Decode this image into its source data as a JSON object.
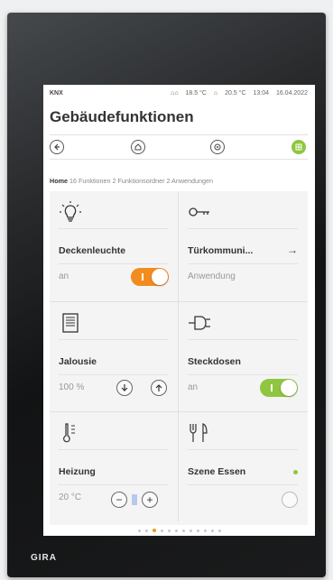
{
  "device": {
    "brand": "GIRA"
  },
  "status": {
    "knx": "KNX",
    "temp_outside": "18.5 °C",
    "temp_inside": "20.5 °C",
    "time": "13:04",
    "date": "16.04.2022"
  },
  "page": {
    "title": "Gebäudefunktionen"
  },
  "nav": {
    "back": "back-icon",
    "home": "home-icon",
    "settings": "settings-icon",
    "grid": "grid-icon"
  },
  "breadcrumb": {
    "home": "Home",
    "info": "16 Funktionen 2 Funktionsordner 2 Anwendungen"
  },
  "tiles": [
    {
      "name": "Deckenleuchte",
      "value": "an",
      "icon": "bulb-icon",
      "switch": "on"
    },
    {
      "name": "Türkommuni...",
      "value": "Anwendung",
      "icon": "key-icon",
      "arrow": "→"
    },
    {
      "name": "Jalousie",
      "value": "100 %",
      "icon": "blind-icon"
    },
    {
      "name": "Steckdosen",
      "value": "an",
      "icon": "plug-icon",
      "switch": "on"
    },
    {
      "name": "Heizung",
      "value": "20 °C",
      "icon": "thermometer-icon",
      "minus": "−",
      "plus": "+"
    },
    {
      "name": "Szene Essen",
      "value": "",
      "icon": "cutlery-icon"
    }
  ],
  "colors": {
    "accent_green": "#8fc63f",
    "accent_orange": "#f28c1f",
    "pager_active": "#e0a020"
  },
  "pager": {
    "count": 12,
    "current": 3
  }
}
